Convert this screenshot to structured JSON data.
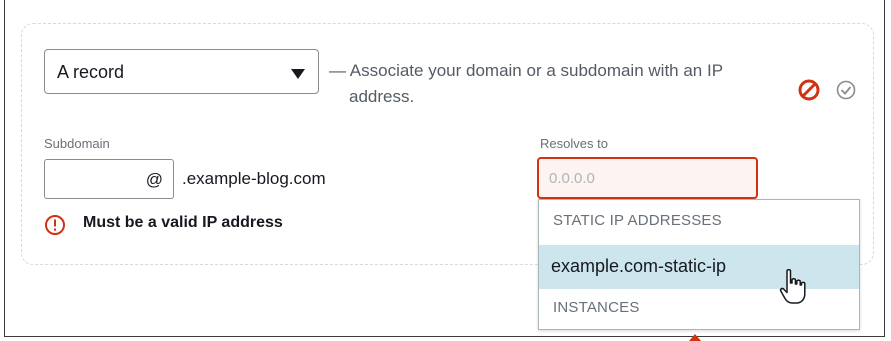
{
  "record_type": {
    "selected": "A record",
    "description_line1": "— Associate your domain or a subdomain with an IP",
    "description_line2": "address."
  },
  "subdomain": {
    "label": "Subdomain",
    "value": "",
    "at_sign": "@",
    "domain_suffix": ".example-blog.com"
  },
  "resolves_to": {
    "label": "Resolves to",
    "placeholder": "0.0.0.0"
  },
  "error": {
    "message": "Must be a valid IP address"
  },
  "dropdown": {
    "groups": [
      {
        "label": "STATIC IP ADDRESSES",
        "items": [
          "example.com-static-ip"
        ]
      },
      {
        "label": "INSTANCES",
        "items": []
      }
    ]
  },
  "icons": {
    "cancel": "cancel-icon",
    "confirm": "confirm-icon",
    "error": "error-icon",
    "cursor": "hand-cursor-icon"
  },
  "colors": {
    "error": "#d13212",
    "highlight": "#cde6ee",
    "confirm_gray": "#8c8c8c"
  }
}
